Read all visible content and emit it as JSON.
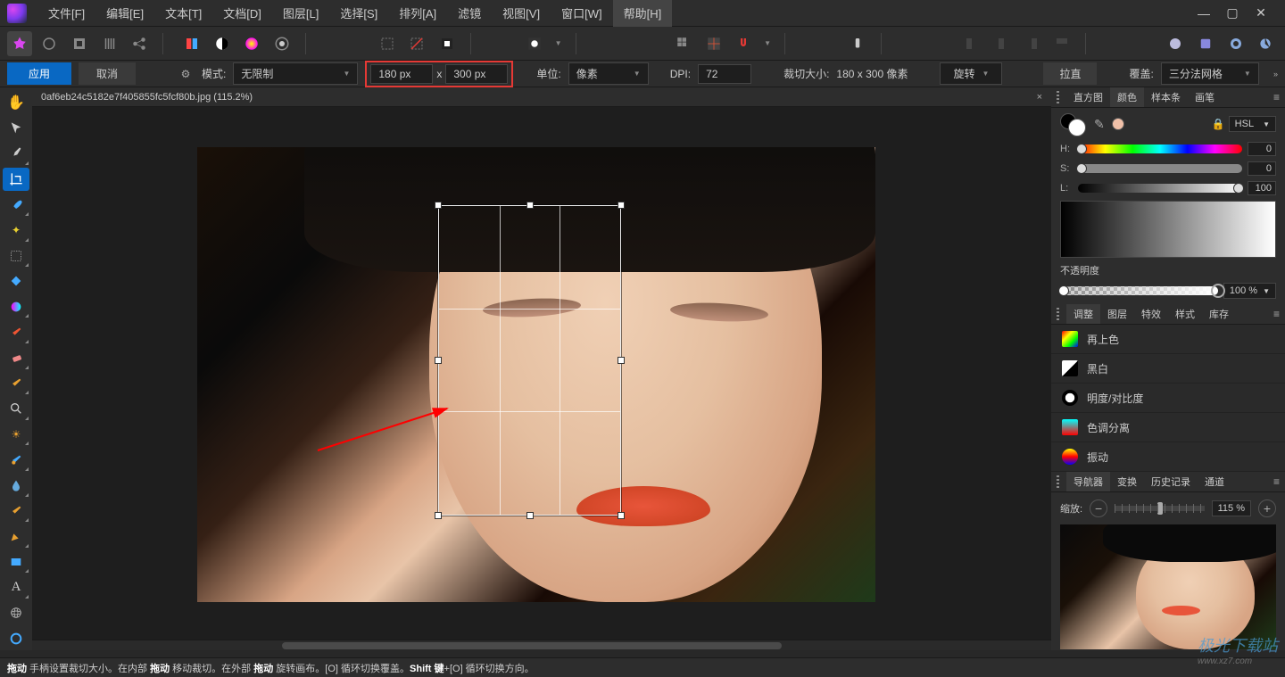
{
  "menu": {
    "items": [
      "文件[F]",
      "编辑[E]",
      "文本[T]",
      "文档[D]",
      "图层[L]",
      "选择[S]",
      "排列[A]",
      "滤镜",
      "视图[V]",
      "窗口[W]",
      "帮助[H]"
    ],
    "active_index": 10
  },
  "options": {
    "apply": "应用",
    "cancel": "取消",
    "mode_label": "模式:",
    "mode_value": "无限制",
    "width": "180 px",
    "multiply": "x",
    "height": "300 px",
    "unit_label": "单位:",
    "unit_value": "像素",
    "dpi_label": "DPI:",
    "dpi_value": "72",
    "crop_size_label": "裁切大小:",
    "crop_size_value": "180 x 300 像素",
    "rotate": "旋转",
    "straighten": "拉直",
    "overlay_label": "覆盖:",
    "overlay_value": "三分法网格"
  },
  "document": {
    "tab_title": "0af6eb24c5182e7f405855fc5fcf80b.jpg (115.2%)"
  },
  "panels": {
    "color_tabs": [
      "直方图",
      "颜色",
      "样本条",
      "画笔"
    ],
    "color_active": 1,
    "hsl": {
      "mode": "HSL",
      "h_label": "H:",
      "s_label": "S:",
      "l_label": "L:",
      "h": "0",
      "s": "0",
      "l": "100"
    },
    "opacity_label": "不透明度",
    "opacity_value": "100 %",
    "adj_tabs": [
      "调整",
      "图层",
      "特效",
      "样式",
      "库存"
    ],
    "adj_active": 0,
    "adjustments": [
      "再上色",
      "黑白",
      "明度/对比度",
      "色调分离",
      "振动"
    ],
    "nav_tabs": [
      "导航器",
      "变换",
      "历史记录",
      "通道"
    ],
    "nav_active": 0,
    "zoom_label": "缩放:",
    "zoom_value": "115 %"
  },
  "status": {
    "text_parts": [
      "拖动",
      " 手柄设置裁切大小。在内部 ",
      "拖动",
      " 移动裁切。在外部 ",
      "拖动",
      " 旋转画布。[O] 循环切换覆盖。",
      "Shift 键",
      "+[O] 循环切换方向。"
    ]
  },
  "watermark": {
    "main": "极光下载站",
    "sub": "www.xz7.com"
  }
}
